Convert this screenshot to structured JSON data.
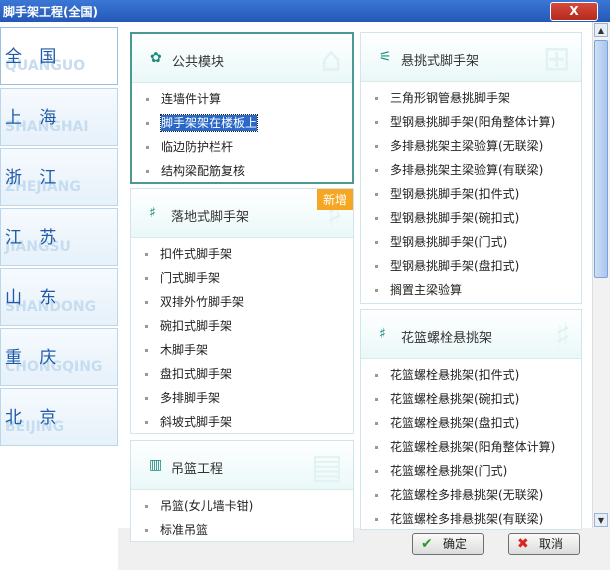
{
  "window": {
    "title": "脚手架工程(全国)",
    "close_label": "X"
  },
  "regions": [
    {
      "name": "全 国",
      "en": "QUANGUO",
      "active": true
    },
    {
      "name": "上 海",
      "en": "SHANGHAI"
    },
    {
      "name": "浙 江",
      "en": "ZHEJIANG"
    },
    {
      "name": "江 苏",
      "en": "JIANGSU"
    },
    {
      "name": "山 东",
      "en": "SHANDONG"
    },
    {
      "name": "重 庆",
      "en": "CHONGQING"
    },
    {
      "name": "北 京",
      "en": "BEIJING"
    }
  ],
  "panels": {
    "common": {
      "title": "公共模块",
      "items": [
        "连墙件计算",
        "脚手架架在楼板上",
        "临边防护栏杆",
        "结构梁配筋复核"
      ],
      "selected_index": 1
    },
    "floor": {
      "title": "落地式脚手架",
      "badge": "新增",
      "items": [
        "扣件式脚手架",
        "门式脚手架",
        "双排外竹脚手架",
        "碗扣式脚手架",
        "木脚手架",
        "盘扣式脚手架",
        "多排脚手架",
        "斜坡式脚手架"
      ]
    },
    "basket": {
      "title": "吊篮工程",
      "items": [
        "吊篮(女儿墙卡钳)",
        "标准吊篮"
      ]
    },
    "cantilever": {
      "title": "悬挑式脚手架",
      "items": [
        "三角形钢管悬挑脚手架",
        "型钢悬挑脚手架(阳角整体计算)",
        "多排悬挑架主梁验算(无联梁)",
        "多排悬挑架主梁验算(有联梁)",
        "型钢悬挑脚手架(扣件式)",
        "型钢悬挑脚手架(碗扣式)",
        "型钢悬挑脚手架(门式)",
        "型钢悬挑脚手架(盘扣式)",
        "搁置主梁验算"
      ]
    },
    "bolt": {
      "title": "花篮螺栓悬挑架",
      "items": [
        "花篮螺栓悬挑架(扣件式)",
        "花篮螺栓悬挑架(碗扣式)",
        "花篮螺栓悬挑架(盘扣式)",
        "花篮螺栓悬挑架(阳角整体计算)",
        "花篮螺栓悬挑架(门式)",
        "花篮螺栓多排悬挑架(无联梁)",
        "花篮螺栓多排悬挑架(有联梁)"
      ]
    }
  },
  "buttons": {
    "ok": "确定",
    "cancel": "取消"
  }
}
